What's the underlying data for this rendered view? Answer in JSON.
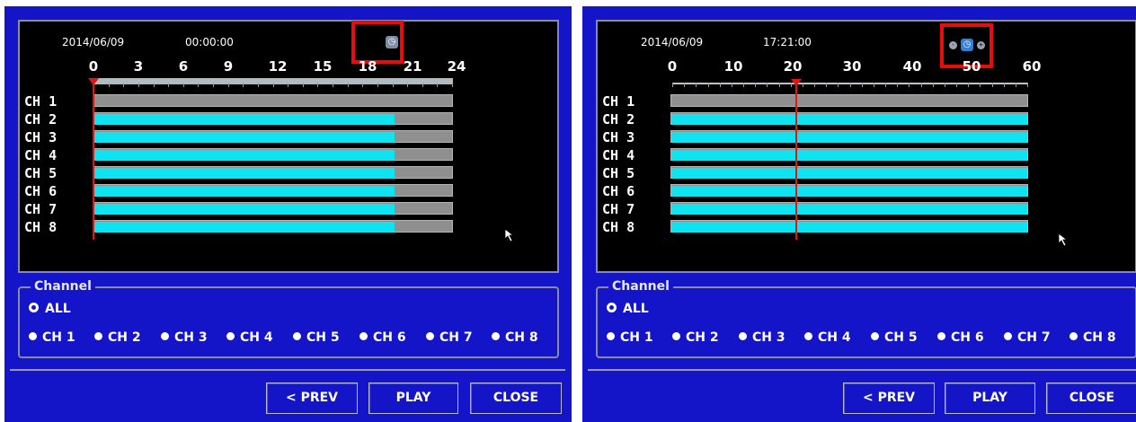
{
  "left": {
    "date": "2014/06/09",
    "time": "00:00:00",
    "scale_labels": [
      "0",
      "3",
      "6",
      "9",
      "12",
      "15",
      "18",
      "21",
      "24"
    ],
    "zoom_icon": "clock-zoom-icon",
    "channels": [
      "CH 1",
      "CH 2",
      "CH 3",
      "CH 4",
      "CH 5",
      "CH 6",
      "CH 7",
      "CH 8"
    ],
    "recorded_fraction": [
      0,
      0.84,
      0.84,
      0.84,
      0.84,
      0.84,
      0.84,
      0.84
    ],
    "channel_group": {
      "title": "Channel",
      "all_label": "ALL",
      "options": [
        "CH 1",
        "CH 2",
        "CH 3",
        "CH 4",
        "CH 5",
        "CH 6",
        "CH 7",
        "CH 8"
      ]
    },
    "buttons": {
      "prev": "< PREV",
      "play": "PLAY",
      "close": "CLOSE"
    }
  },
  "right": {
    "date": "2014/06/09",
    "time": "17:21:00",
    "scale_labels": [
      "0",
      "10",
      "20",
      "30",
      "40",
      "50",
      "60"
    ],
    "zoom_icon": "clock-zoom-icon",
    "channels": [
      "CH 1",
      "CH 2",
      "CH 3",
      "CH 4",
      "CH 5",
      "CH 6",
      "CH 7",
      "CH 8"
    ],
    "recorded_fraction": [
      0,
      1,
      1,
      1,
      1,
      1,
      1,
      1
    ],
    "channel_group": {
      "title": "Channel",
      "all_label": "ALL",
      "options": [
        "CH 1",
        "CH 2",
        "CH 3",
        "CH 4",
        "CH 5",
        "CH 6",
        "CH 7",
        "CH 8"
      ]
    },
    "buttons": {
      "prev": "< PREV",
      "play": "PLAY",
      "close": "CLOSE"
    }
  },
  "colors": {
    "panel_bg": "#1414c8",
    "record_bar": "#0fe3ef",
    "empty_bar": "#8f8f8f",
    "playhead": "#e31414",
    "highlight": "#e80c0c"
  }
}
